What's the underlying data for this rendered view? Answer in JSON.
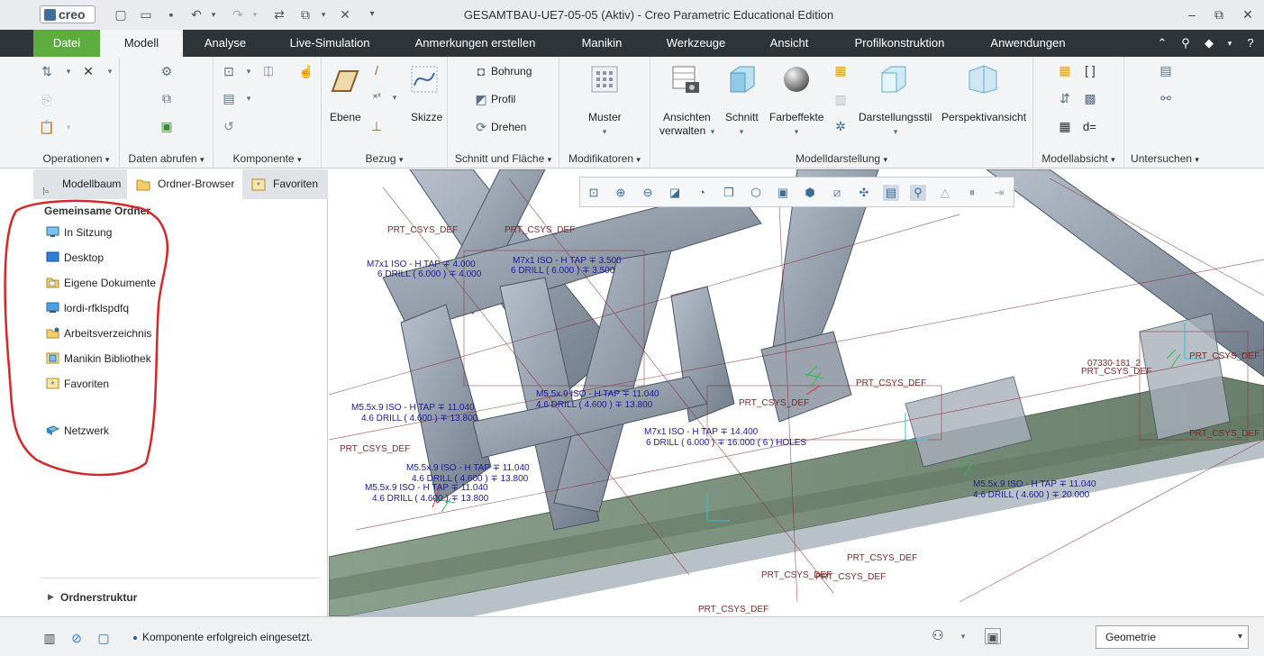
{
  "titlebar": {
    "logo": "creo",
    "title": "GESAMTBAU-UE7-05-05 (Aktiv) - Creo Parametric Educational Edition",
    "quick_access": [
      "new-icon",
      "open-icon",
      "save-icon",
      "undo-icon",
      "redo-icon",
      "regenerate-icon",
      "window-icon",
      "close-window-icon"
    ],
    "window_controls": [
      "minimize-icon",
      "restore-icon",
      "close-icon"
    ]
  },
  "tabs": [
    {
      "label": "Datei"
    },
    {
      "label": "Modell"
    },
    {
      "label": "Analyse"
    },
    {
      "label": "Live-Simulation"
    },
    {
      "label": "Anmerkungen erstellen"
    },
    {
      "label": "Manikin"
    },
    {
      "label": "Werkzeuge"
    },
    {
      "label": "Ansicht"
    },
    {
      "label": "Profilkonstruktion"
    },
    {
      "label": "Anwendungen"
    }
  ],
  "ribbon": {
    "groups": [
      {
        "label": "Operationen"
      },
      {
        "label": "Daten abrufen"
      },
      {
        "label": "Komponente"
      },
      {
        "label": "Bezug"
      },
      {
        "label": "Schnitt und Fläche"
      },
      {
        "label": "Modifikatoren"
      },
      {
        "label": "Modelldarstellung"
      },
      {
        "label": "Modellabsicht"
      },
      {
        "label": "Untersuchen"
      }
    ],
    "bezug": {
      "ebene": "Ebene",
      "skizze": "Skizze"
    },
    "schnitt": {
      "bohrung": "Bohrung",
      "profil": "Profil",
      "drehen": "Drehen"
    },
    "modifikatoren": {
      "muster": "Muster"
    },
    "modelldarstellung": {
      "ansichten": "Ansichten",
      "verwalten": "verwalten",
      "schnitt": "Schnitt",
      "farbeffekte": "Farbeffekte",
      "darstellungsstil": "Darstellungsstil",
      "perspektive": "Perspektivansicht"
    },
    "modellabsicht": {
      "relations": "d="
    }
  },
  "left_panel": {
    "tabs": [
      {
        "label": "Modellbaum"
      },
      {
        "label": "Ordner-Browser"
      },
      {
        "label": "Favoriten"
      }
    ],
    "heading": "Gemeinsame Ordner",
    "folders": [
      {
        "label": "In Sitzung"
      },
      {
        "label": "Desktop"
      },
      {
        "label": "Eigene Dokumente"
      },
      {
        "label": "lordi-rfklspdfq"
      },
      {
        "label": "Arbeitsverzeichnis"
      },
      {
        "label": "Manikin Bibliothek"
      },
      {
        "label": "Favoriten"
      },
      {
        "label": "Netzwerk"
      }
    ],
    "folder_tree": "Ordnerstruktur"
  },
  "viewport": {
    "annotations": [
      {
        "text": "PRT_CSYS_DEF"
      },
      {
        "text": "PRT_CSYS_DEF"
      },
      {
        "text": "M7x1 ISO - H TAP ∓ 4.000"
      },
      {
        "text": "6 DRILL ( 6.000 ) ∓ 4.000"
      },
      {
        "text": "M7x1 ISO - H TAP ∓ 3.500"
      },
      {
        "text": "6 DRILL ( 6.000 ) ∓ 3.500"
      },
      {
        "text": "M5.5x.9 ISO - H TAP ∓ 11.040"
      },
      {
        "text": "4.6 DRILL ( 4.600 ) ∓ 13.800"
      },
      {
        "text": "M5.5x.9 ISO - H TAP ∓ 11.040"
      },
      {
        "text": "4.6 DRILL ( 4.600 ) ∓ 13.800"
      },
      {
        "text": "M7x1 ISO - H TAP ∓ 14.400"
      },
      {
        "text": "6 DRILL ( 6.000 ) ∓ 16.000  ( 6 ) HOLES"
      },
      {
        "text": "PRT_CSYS_DEF"
      },
      {
        "text": "M5.5x.9 ISO - H TAP ∓ 11.040"
      },
      {
        "text": "4.6 DRILL ( 4.600 ) ∓ 13.800"
      },
      {
        "text": "M5.5x.9 ISO - H TAP ∓ 11.040"
      },
      {
        "text": "4.6 DRILL ( 4.600 ) ∓ 13.800"
      },
      {
        "text": "M5.5x.9 ISO - H TAP ∓ 11.040"
      },
      {
        "text": "4.6 DRILL ( 4.600 ) ∓ 20.000"
      },
      {
        "text": "PRT_CSYS_DEF"
      },
      {
        "text": "PRT_CSYS_DEF"
      },
      {
        "text": "PRT_CSYS_DEF"
      },
      {
        "text": "07330-181_2"
      },
      {
        "text": "PRT_CSYS_DEF"
      },
      {
        "text": "PRT_CSYS_DEF"
      },
      {
        "text": "PRT_CSYS_DEF"
      },
      {
        "text": "PRT_CSYS_DEF"
      },
      {
        "text": "PRT_CSYS_DEF"
      },
      {
        "text": "PRT_CSYS_DEF"
      }
    ]
  },
  "status": {
    "message": "Komponente erfolgreich eingesetzt.",
    "filter_value": "Geometrie"
  }
}
